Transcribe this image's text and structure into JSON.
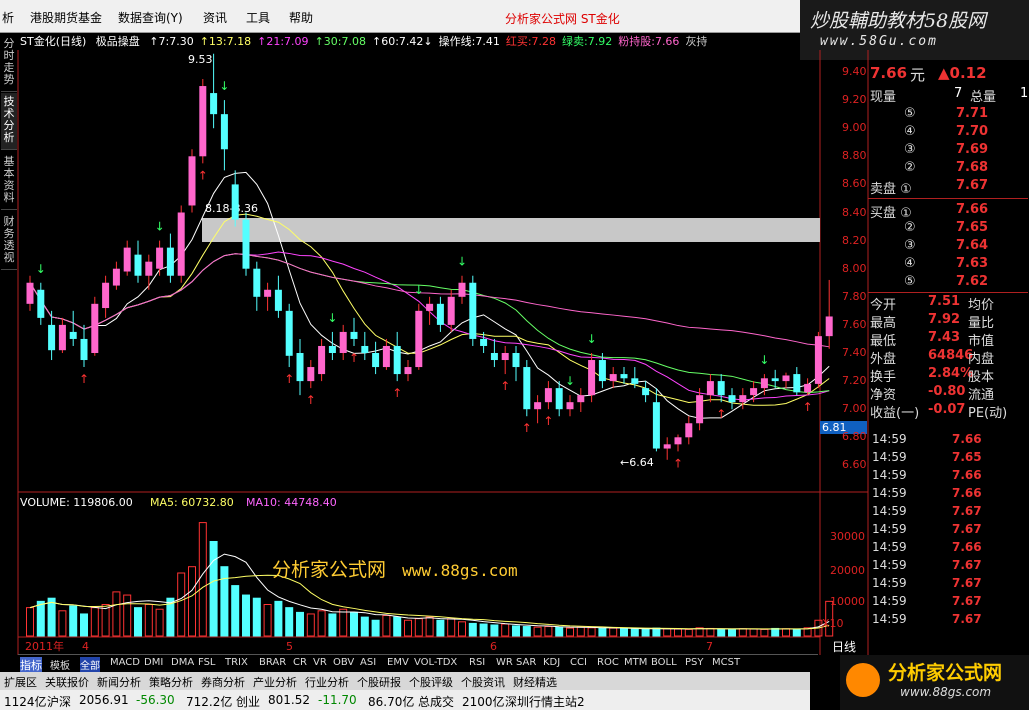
{
  "menu": {
    "items": [
      "析",
      "港股期货基金",
      "数据查询(Y)",
      "资讯",
      "工具",
      "帮助"
    ],
    "center_title": "分析家公式网  ST金化"
  },
  "brand_top": {
    "title": "炒股輔助教材58股网",
    "url": "www.58Gu.com"
  },
  "left_tabs": [
    "分时走势",
    "技术分析",
    "基本资料",
    "财务透视"
  ],
  "chart_header": {
    "stock": "ST金化(日线)",
    "indicator": "极品操盘",
    "items": [
      {
        "text": "↑7:7.30",
        "color": "#ffffff"
      },
      {
        "text": "↑13:7.18",
        "color": "#ffff66"
      },
      {
        "text": "↑21:7.09",
        "color": "#ff44ff"
      },
      {
        "text": "↑30:7.08",
        "color": "#66ff66"
      },
      {
        "text": "↑60:7.42↓",
        "color": "#ffffff"
      },
      {
        "text": "操作线:7.41",
        "color": "#ffffff"
      },
      {
        "text": "红买:7.28",
        "color": "#ff3333"
      },
      {
        "text": "绿卖:7.92",
        "color": "#33ff66"
      },
      {
        "text": "粉持股:7.66",
        "color": "#ff66cc"
      },
      {
        "text": "灰持",
        "color": "#cccccc"
      }
    ]
  },
  "price_axis": [
    "9.40",
    "9.20",
    "9.00",
    "8.80",
    "8.60",
    "8.40",
    "8.20",
    "8.00",
    "7.80",
    "7.60",
    "7.40",
    "7.20",
    "7.00",
    "6.80",
    "6.60"
  ],
  "current_axis_marker": "6.81",
  "volume_axis": [
    "30000",
    "20000",
    "10000",
    "X10"
  ],
  "chart_data": {
    "type": "candlestick",
    "annotations": {
      "high_label": "9.53",
      "low_label": "←6.64",
      "band_label": "8.18-8.36"
    },
    "band": [
      8.18,
      8.36
    ],
    "ylim": [
      6.5,
      9.6
    ],
    "candles": [
      [
        7.75,
        7.95,
        7.7,
        7.9
      ],
      [
        7.85,
        7.9,
        7.6,
        7.65
      ],
      [
        7.6,
        7.7,
        7.35,
        7.42
      ],
      [
        7.42,
        7.65,
        7.4,
        7.6
      ],
      [
        7.55,
        7.7,
        7.45,
        7.5
      ],
      [
        7.5,
        7.6,
        7.3,
        7.35
      ],
      [
        7.4,
        7.8,
        7.38,
        7.75
      ],
      [
        7.72,
        7.95,
        7.65,
        7.9
      ],
      [
        7.88,
        8.05,
        7.85,
        8.0
      ],
      [
        7.98,
        8.2,
        7.95,
        8.15
      ],
      [
        8.1,
        8.2,
        7.9,
        7.95
      ],
      [
        7.95,
        8.1,
        7.85,
        8.05
      ],
      [
        8.0,
        8.2,
        7.95,
        8.15
      ],
      [
        8.15,
        8.25,
        7.9,
        7.95
      ],
      [
        7.95,
        8.45,
        7.9,
        8.4
      ],
      [
        8.45,
        8.85,
        8.4,
        8.8
      ],
      [
        8.8,
        9.35,
        8.75,
        9.3
      ],
      [
        9.25,
        9.53,
        9.0,
        9.1
      ],
      [
        9.1,
        9.2,
        8.7,
        8.85
      ],
      [
        8.6,
        8.7,
        8.3,
        8.35
      ],
      [
        8.35,
        8.4,
        7.95,
        8.0
      ],
      [
        8.0,
        8.05,
        7.7,
        7.8
      ],
      [
        7.8,
        7.9,
        7.7,
        7.85
      ],
      [
        7.85,
        7.95,
        7.65,
        7.7
      ],
      [
        7.7,
        7.75,
        7.3,
        7.38
      ],
      [
        7.4,
        7.5,
        7.1,
        7.2
      ],
      [
        7.2,
        7.35,
        7.15,
        7.3
      ],
      [
        7.25,
        7.5,
        7.2,
        7.45
      ],
      [
        7.45,
        7.55,
        7.35,
        7.4
      ],
      [
        7.4,
        7.6,
        7.35,
        7.55
      ],
      [
        7.55,
        7.65,
        7.45,
        7.5
      ],
      [
        7.45,
        7.55,
        7.35,
        7.4
      ],
      [
        7.4,
        7.48,
        7.25,
        7.3
      ],
      [
        7.3,
        7.5,
        7.28,
        7.45
      ],
      [
        7.45,
        7.55,
        7.2,
        7.25
      ],
      [
        7.25,
        7.35,
        7.2,
        7.3
      ],
      [
        7.3,
        7.75,
        7.28,
        7.7
      ],
      [
        7.7,
        7.8,
        7.6,
        7.75
      ],
      [
        7.75,
        7.8,
        7.55,
        7.6
      ],
      [
        7.6,
        7.85,
        7.55,
        7.8
      ],
      [
        7.8,
        7.95,
        7.75,
        7.9
      ],
      [
        7.9,
        7.95,
        7.45,
        7.5
      ],
      [
        7.5,
        7.55,
        7.4,
        7.45
      ],
      [
        7.4,
        7.5,
        7.3,
        7.35
      ],
      [
        7.35,
        7.45,
        7.25,
        7.4
      ],
      [
        7.4,
        7.45,
        7.2,
        7.3
      ],
      [
        7.3,
        7.35,
        6.95,
        7.0
      ],
      [
        7.0,
        7.1,
        6.9,
        7.05
      ],
      [
        7.05,
        7.2,
        7.0,
        7.15
      ],
      [
        7.15,
        7.2,
        6.95,
        7.0
      ],
      [
        7.0,
        7.1,
        6.95,
        7.05
      ],
      [
        7.05,
        7.15,
        6.98,
        7.1
      ],
      [
        7.1,
        7.4,
        7.05,
        7.35
      ],
      [
        7.35,
        7.4,
        7.15,
        7.2
      ],
      [
        7.2,
        7.3,
        7.15,
        7.25
      ],
      [
        7.25,
        7.3,
        7.18,
        7.22
      ],
      [
        7.22,
        7.3,
        7.15,
        7.18
      ],
      [
        7.15,
        7.2,
        7.05,
        7.1
      ],
      [
        7.05,
        7.15,
        6.7,
        6.72
      ],
      [
        6.72,
        6.8,
        6.64,
        6.75
      ],
      [
        6.75,
        6.82,
        6.7,
        6.8
      ],
      [
        6.8,
        6.95,
        6.75,
        6.9
      ],
      [
        6.9,
        7.15,
        6.85,
        7.1
      ],
      [
        7.1,
        7.25,
        7.05,
        7.2
      ],
      [
        7.2,
        7.25,
        7.05,
        7.1
      ],
      [
        7.1,
        7.15,
        7.0,
        7.05
      ],
      [
        7.05,
        7.15,
        7.0,
        7.1
      ],
      [
        7.1,
        7.2,
        7.05,
        7.15
      ],
      [
        7.15,
        7.25,
        7.1,
        7.22
      ],
      [
        7.22,
        7.28,
        7.15,
        7.2
      ],
      [
        7.2,
        7.26,
        7.15,
        7.24
      ],
      [
        7.25,
        7.3,
        7.1,
        7.12
      ],
      [
        7.12,
        7.22,
        7.1,
        7.18
      ],
      [
        7.18,
        7.55,
        7.15,
        7.52
      ],
      [
        7.52,
        7.92,
        7.43,
        7.66
      ]
    ],
    "volume_label": "VOLUME: 119806.00",
    "ma5_label": "MA5: 60732.80",
    "ma10_label": "MA10: 44748.40",
    "volumes": [
      9000,
      11000,
      12000,
      8000,
      9500,
      7000,
      9000,
      10000,
      14000,
      13000,
      9000,
      10000,
      8500,
      12000,
      20000,
      22000,
      36000,
      30000,
      22000,
      16000,
      13000,
      12000,
      10000,
      11000,
      9000,
      7500,
      7000,
      8000,
      7000,
      8500,
      7500,
      6000,
      5000,
      6500,
      6000,
      5000,
      5500,
      6000,
      5000,
      5500,
      4500,
      4000,
      3800,
      3500,
      3800,
      3200,
      3000,
      2800,
      3000,
      2700,
      2500,
      2800,
      2600,
      2400,
      2500,
      2300,
      2200,
      2100,
      2500,
      2300,
      2200,
      2100,
      2600,
      2400,
      2200,
      2100,
      2300,
      2200,
      2100,
      2400,
      2300,
      2200,
      2600,
      5000,
      11000
    ]
  },
  "date_axis": [
    "2011年",
    "4",
    "5",
    "6",
    "7"
  ],
  "quote": {
    "price": "7.66",
    "price_unit": "元",
    "change": "▲0.12",
    "volume_now_label": "现量",
    "volume_now": "7",
    "total_volume_label": "总量",
    "total_volume": "1",
    "sell_levels": [
      {
        "label": "⑤",
        "price": "7.71"
      },
      {
        "label": "④",
        "price": "7.70"
      },
      {
        "label": "③",
        "price": "7.69"
      },
      {
        "label": "②",
        "price": "7.68"
      },
      {
        "label": "卖盘 ①",
        "price": "7.67"
      }
    ],
    "buy_levels": [
      {
        "label": "买盘 ①",
        "price": "7.66"
      },
      {
        "label": "②",
        "price": "7.65"
      },
      {
        "label": "③",
        "price": "7.64"
      },
      {
        "label": "④",
        "price": "7.63"
      },
      {
        "label": "⑤",
        "price": "7.62"
      }
    ],
    "stats": [
      {
        "l": "今开",
        "v": "7.51",
        "l2": "均价"
      },
      {
        "l": "最高",
        "v": "7.92",
        "l2": "量比"
      },
      {
        "l": "最低",
        "v": "7.43",
        "l2": "市值"
      },
      {
        "l": "外盘",
        "v": "64846",
        "l2": "内盘"
      },
      {
        "l": "换手",
        "v": "2.84%",
        "l2": "股本"
      },
      {
        "l": "净资",
        "v": "-0.80",
        "l2": "流通"
      },
      {
        "l": "收益(一)",
        "v": "-0.07",
        "l2": "PE(动)"
      }
    ]
  },
  "ticks": [
    {
      "t": "14:59",
      "p": "7.66"
    },
    {
      "t": "14:59",
      "p": "7.65"
    },
    {
      "t": "14:59",
      "p": "7.66"
    },
    {
      "t": "14:59",
      "p": "7.66"
    },
    {
      "t": "14:59",
      "p": "7.67"
    },
    {
      "t": "14:59",
      "p": "7.67"
    },
    {
      "t": "14:59",
      "p": "7.66"
    },
    {
      "t": "14:59",
      "p": "7.67"
    },
    {
      "t": "14:59",
      "p": "7.67"
    },
    {
      "t": "14:59",
      "p": "7.67"
    },
    {
      "t": "14:59",
      "p": "7.67"
    }
  ],
  "period_label": "日线",
  "indicator_tabs": [
    "指标",
    "模板",
    "全部",
    "MACD",
    "DMI",
    "DMA",
    "FSL",
    "TRIX",
    "BRAR",
    "CR",
    "VR",
    "OBV",
    "ASI",
    "EMV",
    "VOL-TDX",
    "RSI",
    "WR",
    "SAR",
    "KDJ",
    "CCI",
    "ROC",
    "MTM",
    "BOLL",
    "PSY",
    "MCST"
  ],
  "func_tabs": [
    "扩展区",
    "关联报价",
    "新闻分析",
    "策略分析",
    "券商分析",
    "产业分析",
    "行业分析",
    "个股研报",
    "个股评级",
    "个股资讯",
    "财经精选"
  ],
  "status": [
    "1124亿",
    "沪深",
    "2056.91",
    "-56.30",
    "712.2亿",
    "创业",
    "801.52",
    "-11.70",
    "86.70亿",
    "总成交",
    "2100亿",
    "深圳行情主站2"
  ],
  "watermark": {
    "text": "分析家公式网",
    "url": "www.88gs.com"
  },
  "brand_bottom": {
    "title": "分析家公式网",
    "url": "www.88gs.com"
  },
  "colors": {
    "up": "#ff3333",
    "down": "#54ffff",
    "ma7": "#ffffff",
    "ma13": "#ffff66",
    "ma21": "#ff44ff",
    "ma30": "#66ff66",
    "band": "#c8c8c8"
  }
}
